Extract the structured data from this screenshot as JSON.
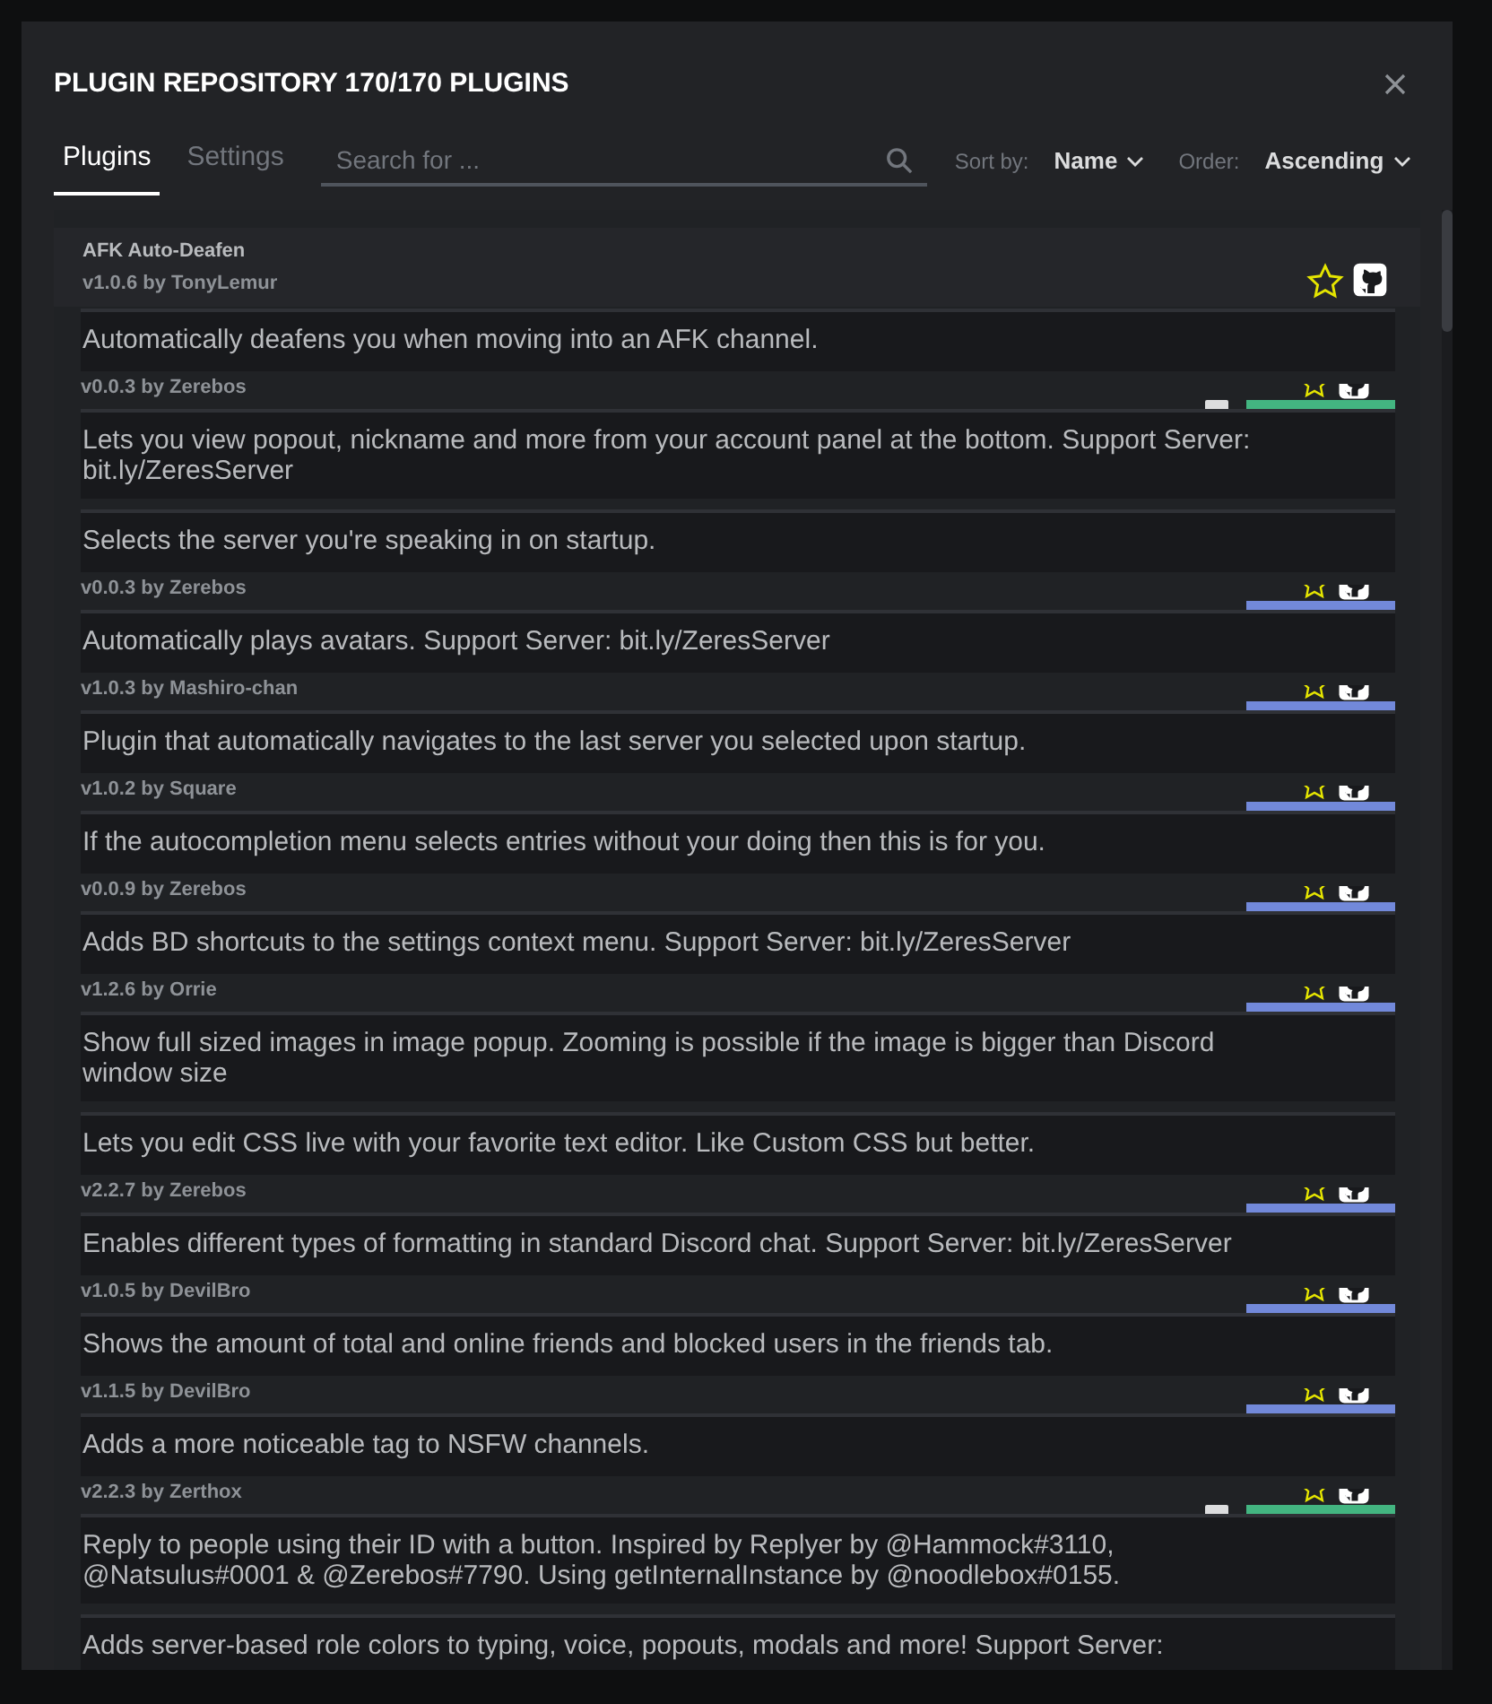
{
  "modal": {
    "title": "PLUGIN REPOSITORY 170/170 PLUGINS",
    "tabs": [
      {
        "label": "Plugins",
        "selected": true
      },
      {
        "label": "Settings",
        "selected": false
      }
    ],
    "search": {
      "placeholder": "Search for ..."
    },
    "sort": {
      "label": "Sort by:",
      "value": "Name"
    },
    "order": {
      "label": "Order:",
      "value": "Ascending"
    }
  },
  "first_plugin": {
    "name": "AFK Auto-Deafen",
    "version": "v1.0.6 by TonyLemur",
    "favorite": false
  },
  "rows": [
    {
      "description": "Automatically deafens you when moving into an AFK channel.",
      "version": "v0.0.3 by Zerebos",
      "kind": "update"
    },
    {
      "description": "Lets you view popout, nickname and more from your account panel at the bottom. Support Server: bit.ly/ZeresServer",
      "kind": "plain"
    },
    {
      "description": "Selects the server you're speaking in on startup.",
      "version": "v0.0.3 by Zerebos",
      "kind": "download"
    },
    {
      "description": "Automatically plays avatars. Support Server: bit.ly/ZeresServer",
      "version": "v1.0.3 by Mashiro-chan",
      "kind": "download"
    },
    {
      "description": "Plugin that automatically navigates to the last server you selected upon startup.",
      "version": "v1.0.2 by Square",
      "kind": "download"
    },
    {
      "description": "If the autocompletion menu selects entries without your doing then this is for you.",
      "version": "v0.0.9 by Zerebos",
      "kind": "download"
    },
    {
      "description": "Adds BD shortcuts to the settings context menu. Support Server: bit.ly/ZeresServer",
      "version": "v1.2.6 by Orrie",
      "kind": "download"
    },
    {
      "description": "Show full sized images in image popup. Zooming is possible if the image is bigger than Discord window size",
      "kind": "plain"
    },
    {
      "description": "Lets you edit CSS live with your favorite text editor. Like Custom CSS but better.",
      "version": "v2.2.7 by Zerebos",
      "kind": "download"
    },
    {
      "description": "Enables different types of formatting in standard Discord chat. Support Server: bit.ly/ZeresServer",
      "version": "v1.0.5 by DevilBro",
      "kind": "download"
    },
    {
      "description": "Shows the amount of total and online friends and blocked users in the friends tab.",
      "version": "v1.1.5 by DevilBro",
      "kind": "download"
    },
    {
      "description": "Adds a more noticeable tag to NSFW channels.",
      "version": "v2.2.3 by Zerthox",
      "kind": "update"
    },
    {
      "description": "Reply to people using their ID with a button. Inspired by Replyer by @Hammock#3110, @Natsulus#0001 & @Zerebos#7790. Using getInternalInstance by @noodlebox#0155.",
      "kind": "plain"
    },
    {
      "description": "Adds server-based role colors to typing, voice, popouts, modals and more! Support Server:",
      "kind": "plain"
    }
  ]
}
